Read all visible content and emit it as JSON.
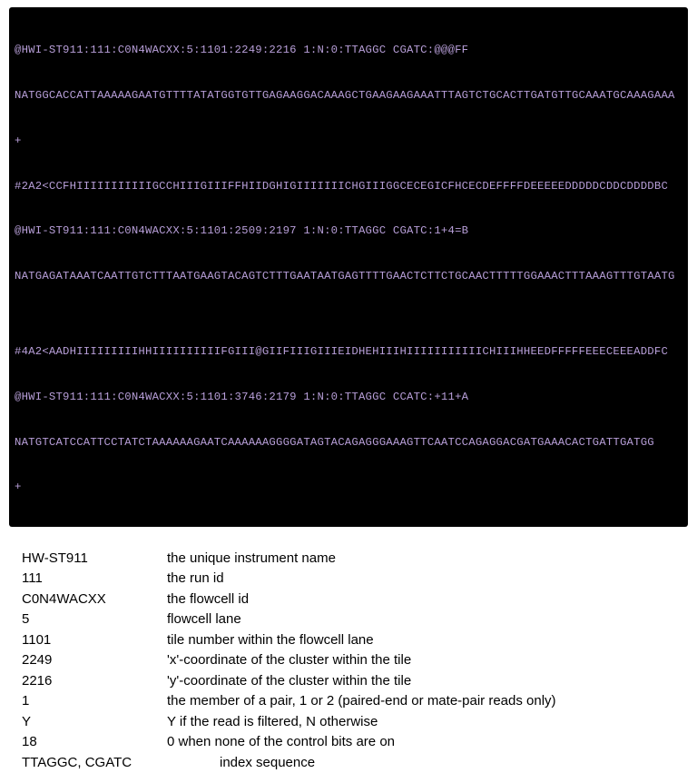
{
  "terminal": {
    "lines": [
      "@HWI-ST911:111:C0N4WACXX:5:1101:2249:2216 1:N:0:TTAGGC CGATC:@@@FF",
      "NATGGCACCATTAAAAAGAATGTTTTATATGGTGTTGAGAAGGACAAAGCTGAAGAAGAAATTTAGTCTGCACTTGATGTTGCAAATGCAAAGAAA",
      "+",
      "#2A2<CCFHIIIIIIIIIIIGCCHIIIGIIIFFHIIDGHIGIIIIIIICHGIIIGGCECEGICFHCECDEFFFFDEEEEEDDDDDCDDCDDDDBC",
      "@HWI-ST911:111:C0N4WACXX:5:1101:2509:2197 1:N:0:TTAGGC CGATC:1+4=B",
      "NATGAGATAAATCAATTGTCTTTAATGAAGTACAGTCTTTGAATAATGAGTTTTGAACTCTTCTGCAACTTTTTGGAAACTTTAAAGTTTGTAATG",
      "",
      "#4A2<AADHIIIIIIIIIHHIIIIIIIIIIFGIII@GIIFIIIGIIIEIDHEHIIIHIIIIIIIIIIICHIIIHHEEDFFFFFEEECEEEADDFC",
      "@HWI-ST911:111:C0N4WACXX:5:1101:3746:2179 1:N:0:TTAGGC CCATC:+11+A",
      "NATGTCATCCATTCCTATCTAAAAAAGAATCAAAAAAGGGGATAGTACAGAGGGAAAGTTCAATCCAGAGGACGATGAAACACTGATTGATGG",
      "+"
    ]
  },
  "legend": {
    "rows": [
      {
        "key": "HW-ST911",
        "desc": "the unique instrument name"
      },
      {
        "key": "111",
        "desc": "the run id"
      },
      {
        "key": "C0N4WACXX",
        "desc": "the flowcell id"
      },
      {
        "key": "5",
        "desc": "flowcell lane"
      },
      {
        "key": "1101",
        "desc": "tile number within the flowcell lane"
      },
      {
        "key": "2249",
        "desc": "'x'-coordinate of the cluster within the tile"
      },
      {
        "key": "2216",
        "desc": "'y'-coordinate of the cluster within the tile"
      },
      {
        "key": "1",
        "desc": "the member of a pair, 1 or 2 (paired-end or mate-pair reads only)"
      },
      {
        "key": "Y",
        "desc": "Y if the read is filtered, N otherwise"
      },
      {
        "key": "18",
        "desc": "0 when none of the control bits are on"
      },
      {
        "key": "TTAGGC, CGATC",
        "desc": "index sequence",
        "wide": true
      }
    ]
  }
}
